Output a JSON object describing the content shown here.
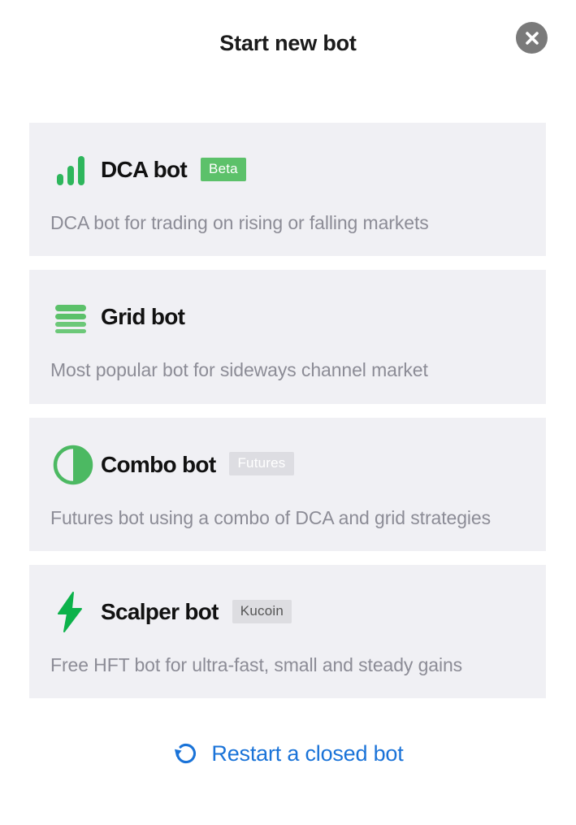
{
  "header": {
    "title": "Start new bot",
    "close_icon": "close-icon",
    "close_color": "#7a7a7a"
  },
  "colors": {
    "card_background": "#f0f0f4",
    "accent_green": "#2eb65c",
    "badge_green": "#5cc16a",
    "link_blue": "#1a73d8",
    "title_text": "#111111",
    "description_text": "#8c8c96"
  },
  "bots": [
    {
      "icon": "bar-chart-icon",
      "title": "DCA bot",
      "badge": "Beta",
      "badge_style": "beta",
      "description": "DCA bot for trading on rising or falling markets"
    },
    {
      "icon": "grid-lines-icon",
      "title": "Grid bot",
      "badge": "",
      "badge_style": "none",
      "description": "Most popular bot for sideways channel market"
    },
    {
      "icon": "half-circle-icon",
      "title": "Combo bot",
      "badge": "Futures",
      "badge_style": "futures",
      "description": "Futures bot using a combo of DCA and grid strategies"
    },
    {
      "icon": "lightning-bolt-icon",
      "title": "Scalper bot",
      "badge": "Kucoin",
      "badge_style": "kucoin",
      "description": "Free HFT bot for ultra-fast, small and steady gains"
    }
  ],
  "footer": {
    "restart_label": "Restart a closed bot",
    "restart_icon": "refresh-counterclockwise-icon"
  }
}
